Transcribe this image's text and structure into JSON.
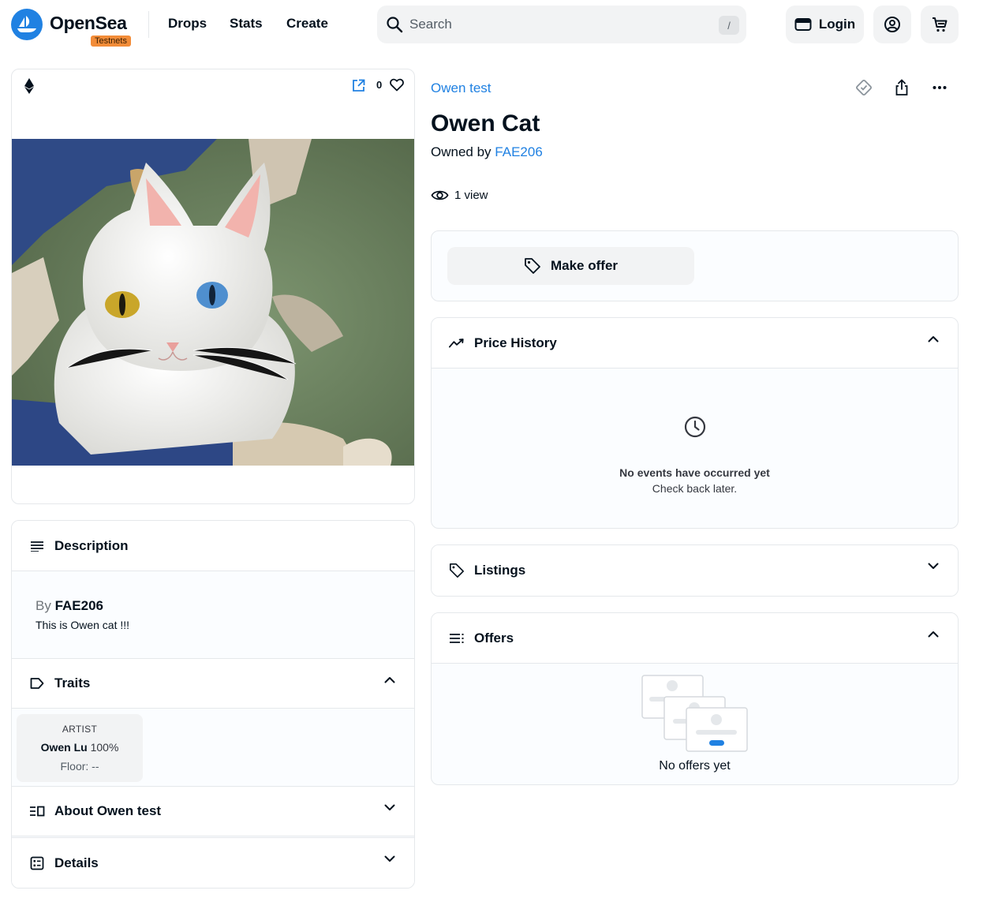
{
  "header": {
    "brand": "OpenSea",
    "badge": "Testnets",
    "nav": [
      "Drops",
      "Stats",
      "Create"
    ],
    "search_placeholder": "Search",
    "search_shortcut": "/",
    "login_label": "Login"
  },
  "media": {
    "chain_icon": "ethereum-icon",
    "favorites_count": "0"
  },
  "item": {
    "collection": "Owen test",
    "title": "Owen Cat",
    "owned_by_label": "Owned by",
    "owner": "FAE206",
    "views": "1 view"
  },
  "actions": {
    "make_offer_label": "Make offer"
  },
  "price_history": {
    "title": "Price History",
    "empty_title": "No events have occurred yet",
    "empty_sub": "Check back later."
  },
  "listings": {
    "title": "Listings"
  },
  "offers": {
    "title": "Offers",
    "empty": "No offers yet"
  },
  "description": {
    "title": "Description",
    "by_label": "By",
    "creator": "FAE206",
    "text": "This is Owen cat !!!"
  },
  "traits": {
    "title": "Traits",
    "items": [
      {
        "type": "ARTIST",
        "value": "Owen Lu",
        "percent": "100%",
        "floor": "Floor: --"
      }
    ]
  },
  "about": {
    "title": "About Owen test"
  },
  "details": {
    "title": "Details"
  },
  "colors": {
    "accent": "#2081e2",
    "badge": "#f28c38"
  }
}
